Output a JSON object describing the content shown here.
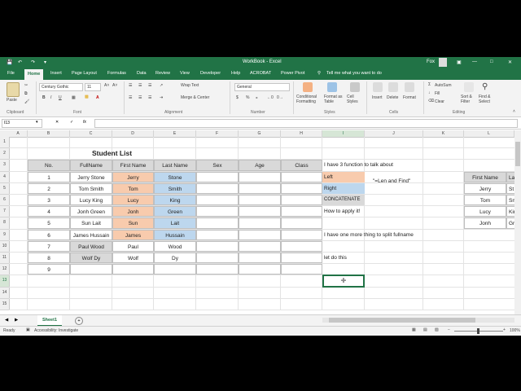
{
  "window": {
    "title": "WorkBook - Excel",
    "user": "Fox"
  },
  "quick_access": {
    "autosave_icon": "save-icon"
  },
  "tabs": [
    "File",
    "Home",
    "Insert",
    "Page Layout",
    "Formulas",
    "Data",
    "Review",
    "View",
    "Developer",
    "Help",
    "ACROBAT",
    "Power Pivot",
    "Tell me what you want to do"
  ],
  "ribbon": {
    "clipboard": {
      "paste": "Paste",
      "group": "Clipboard"
    },
    "font": {
      "name": "Century Gothic",
      "size": "11",
      "group": "Font",
      "bold": "B",
      "italic": "I",
      "underline": "U"
    },
    "alignment": {
      "wrap": "Wrap Text",
      "merge": "Merge & Center",
      "group": "Alignment"
    },
    "number": {
      "format": "General",
      "group": "Number",
      "currency": "$",
      "percent": "%"
    },
    "styles": {
      "conditional": "Conditional Formatting",
      "format_table": "Format as Table",
      "cell_styles": "Cell Styles",
      "group": "Styles"
    },
    "cells": {
      "insert": "Insert",
      "delete": "Delete",
      "format": "Format",
      "group": "Cells"
    },
    "editing": {
      "autosum": "AutoSum",
      "fill": "Fill",
      "clear": "Clear",
      "sort": "Sort & Filter",
      "find": "Find & Select",
      "group": "Editing"
    }
  },
  "formula_bar": {
    "name_box": "I13",
    "fx": "fx",
    "value": ""
  },
  "columns": [
    "A",
    "B",
    "C",
    "D",
    "E",
    "F",
    "G",
    "H",
    "I",
    "J",
    "K",
    "L"
  ],
  "rows": [
    "1",
    "2",
    "3",
    "4",
    "5",
    "6",
    "7",
    "8",
    "9",
    "10",
    "11",
    "12",
    "13",
    "14",
    "15"
  ],
  "sheet": {
    "title": "Student List",
    "headers": [
      "No.",
      "FullName",
      "First Name",
      "Last Name",
      "Sex",
      "Age",
      "Class"
    ],
    "students": [
      [
        "1",
        "Jerry Stone",
        "Jerry",
        "Stone"
      ],
      [
        "2",
        "Tom Smith",
        "Tom",
        "Smith"
      ],
      [
        "3",
        "Lucy King",
        "Lucy",
        "King"
      ],
      [
        "4",
        "Jonh Green",
        "Jonh",
        "Green"
      ],
      [
        "5",
        "Sun Lait",
        "Sun",
        "Lait"
      ],
      [
        "6",
        "James Hussain",
        "James",
        "Hussain"
      ],
      [
        "7",
        "Paul Wood",
        "Paul",
        "Wood"
      ],
      [
        "8",
        "Wolf Dy",
        "Wolf",
        "Dy"
      ],
      [
        "9",
        "",
        "",
        ""
      ]
    ],
    "notes": {
      "n1": "I have 3 function  to talk about",
      "left": "Left",
      "right": "Right",
      "concat": "CONCATENATE",
      "how": "How to apply it!",
      "lenfind": "\"=Len and Find\"",
      "more": "I have one more thing to split fullname",
      "letdo": "let do this"
    },
    "side_table": {
      "header": "First Name",
      "header2": "La",
      "names": [
        "Jerry",
        "Tom",
        "Lucy",
        "Jonh"
      ],
      "last": [
        "St",
        "Sm",
        "Kin",
        "Gr"
      ]
    }
  },
  "sheet_tabs": {
    "active": "Sheet1",
    "add": "+"
  },
  "status": {
    "ready": "Ready",
    "accessibility": "Accessibility: Investigate",
    "zoom": "100%"
  },
  "colors": {
    "excel_green": "#217346",
    "orange": "#f8cbad",
    "blue": "#bdd7ee",
    "gray": "#d9d9d9"
  }
}
